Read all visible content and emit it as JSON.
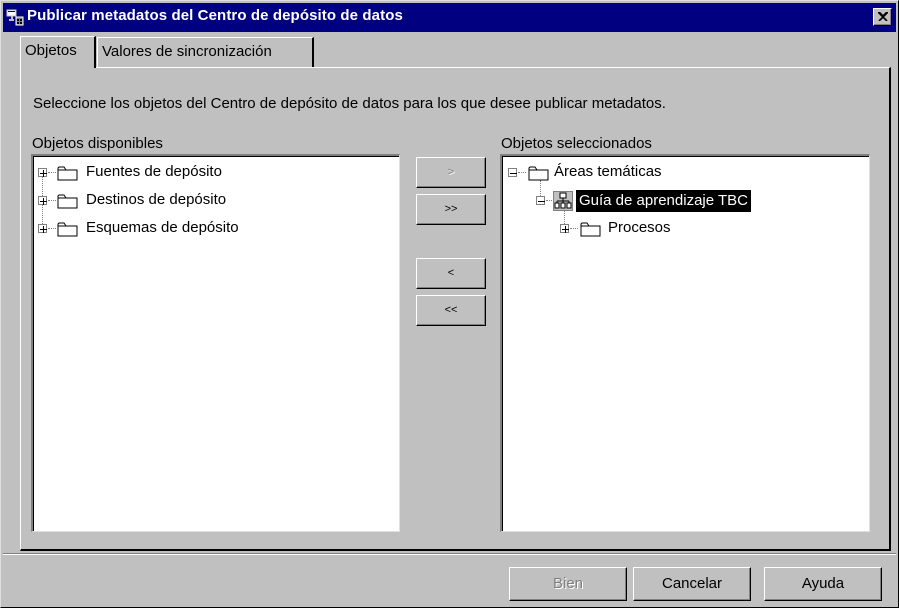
{
  "window": {
    "title": "Publicar metadatos del Centro de depósito de datos",
    "close_label": "×"
  },
  "tabs": [
    {
      "label": "Objetos",
      "active": true
    },
    {
      "label": "Valores de sincronización",
      "active": false
    }
  ],
  "instructions": "Seleccione los objetos del Centro de depósito de datos para los que desee publicar metadatos.",
  "available": {
    "label": "Objetos disponibles",
    "items": [
      {
        "label": "Fuentes de depósito",
        "icon": "folder-icon",
        "expander": "+"
      },
      {
        "label": "Destinos de depósito",
        "icon": "folder-icon",
        "expander": "+"
      },
      {
        "label": "Esquemas de depósito",
        "icon": "folder-icon",
        "expander": "+"
      }
    ]
  },
  "selected": {
    "label": "Objetos seleccionados",
    "items": [
      {
        "label": "Áreas temáticas",
        "icon": "folder-icon",
        "expander": "-",
        "level": 0
      },
      {
        "label": "Guía de aprendizaje TBC",
        "icon": "subject-area-icon",
        "expander": "-",
        "level": 1,
        "highlighted": true
      },
      {
        "label": "Procesos",
        "icon": "folder-icon",
        "expander": "+",
        "level": 2
      }
    ]
  },
  "move_buttons": {
    "add": ">",
    "add_all": ">>",
    "remove": "<",
    "remove_all": "<<"
  },
  "footer": {
    "ok": "Bien",
    "cancel": "Cancelar",
    "help": "Ayuda"
  },
  "colors": {
    "titlebar": "#000080",
    "face": "#c0c0c0",
    "selection": "#000000"
  }
}
